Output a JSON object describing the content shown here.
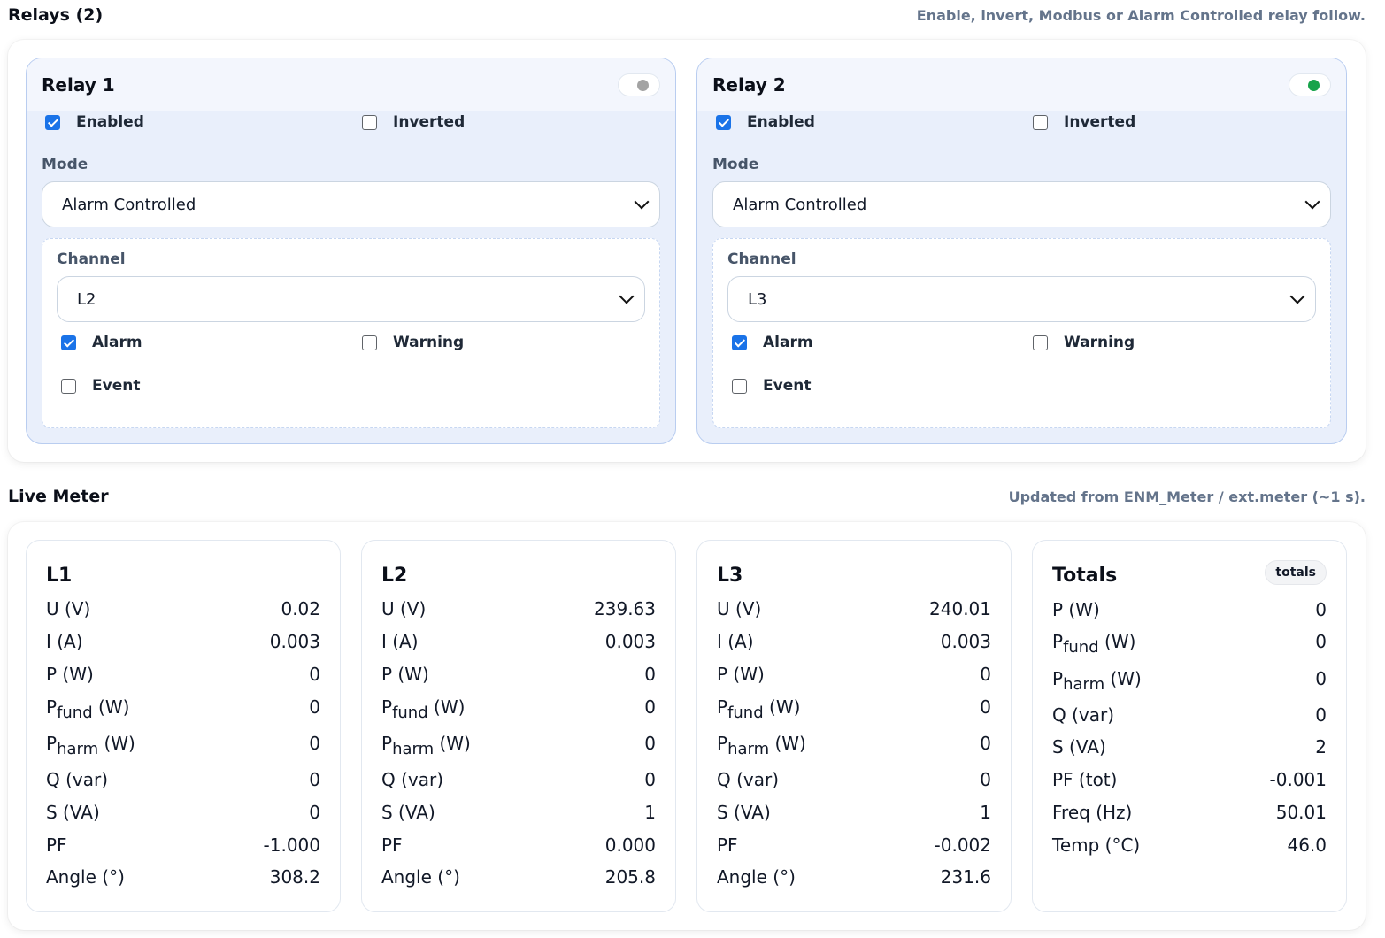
{
  "relays_section": {
    "title": "Relays (2)",
    "hint": "Enable, invert, Modbus or Alarm Controlled relay follow."
  },
  "relays": [
    {
      "title": "Relay 1",
      "status_color": "#a3a3a3",
      "enabled_label": "Enabled",
      "enabled": true,
      "inverted_label": "Inverted",
      "inverted": false,
      "mode_label": "Mode",
      "mode_value": "Alarm Controlled",
      "channel_label": "Channel",
      "channel_value": "L2",
      "alarm_label": "Alarm",
      "alarm": true,
      "warning_label": "Warning",
      "warning": false,
      "event_label": "Event",
      "event": false
    },
    {
      "title": "Relay 2",
      "status_color": "#16a34a",
      "enabled_label": "Enabled",
      "enabled": true,
      "inverted_label": "Inverted",
      "inverted": false,
      "mode_label": "Mode",
      "mode_value": "Alarm Controlled",
      "channel_label": "Channel",
      "channel_value": "L3",
      "alarm_label": "Alarm",
      "alarm": true,
      "warning_label": "Warning",
      "warning": false,
      "event_label": "Event",
      "event": false
    }
  ],
  "meter_section": {
    "title": "Live Meter",
    "hint": "Updated from ENM_Meter / ext.meter (~1 s)."
  },
  "phases": [
    {
      "title": "L1",
      "rows": [
        {
          "label": "U (V)",
          "value": "0.02"
        },
        {
          "label": "I (A)",
          "value": "0.003"
        },
        {
          "label": "P (W)",
          "value": "0"
        },
        {
          "label_main": "P",
          "label_sub": "fund",
          "label_unit": " (W)",
          "value": "0"
        },
        {
          "label_main": "P",
          "label_sub": "harm",
          "label_unit": " (W)",
          "value": "0"
        },
        {
          "label": "Q (var)",
          "value": "0"
        },
        {
          "label": "S (VA)",
          "value": "0"
        },
        {
          "label": "PF",
          "value": "-1.000"
        },
        {
          "label": "Angle (°)",
          "value": "308.2"
        }
      ]
    },
    {
      "title": "L2",
      "rows": [
        {
          "label": "U (V)",
          "value": "239.63"
        },
        {
          "label": "I (A)",
          "value": "0.003"
        },
        {
          "label": "P (W)",
          "value": "0"
        },
        {
          "label_main": "P",
          "label_sub": "fund",
          "label_unit": " (W)",
          "value": "0"
        },
        {
          "label_main": "P",
          "label_sub": "harm",
          "label_unit": " (W)",
          "value": "0"
        },
        {
          "label": "Q (var)",
          "value": "0"
        },
        {
          "label": "S (VA)",
          "value": "1"
        },
        {
          "label": "PF",
          "value": "0.000"
        },
        {
          "label": "Angle (°)",
          "value": "205.8"
        }
      ]
    },
    {
      "title": "L3",
      "rows": [
        {
          "label": "U (V)",
          "value": "240.01"
        },
        {
          "label": "I (A)",
          "value": "0.003"
        },
        {
          "label": "P (W)",
          "value": "0"
        },
        {
          "label_main": "P",
          "label_sub": "fund",
          "label_unit": " (W)",
          "value": "0"
        },
        {
          "label_main": "P",
          "label_sub": "harm",
          "label_unit": " (W)",
          "value": "0"
        },
        {
          "label": "Q (var)",
          "value": "0"
        },
        {
          "label": "S (VA)",
          "value": "1"
        },
        {
          "label": "PF",
          "value": "-0.002"
        },
        {
          "label": "Angle (°)",
          "value": "231.6"
        }
      ]
    }
  ],
  "totals": {
    "title": "Totals",
    "badge": "totals",
    "rows": [
      {
        "label": "P (W)",
        "value": "0"
      },
      {
        "label_main": "P",
        "label_sub": "fund",
        "label_unit": " (W)",
        "value": "0"
      },
      {
        "label_main": "P",
        "label_sub": "harm",
        "label_unit": " (W)",
        "value": "0"
      },
      {
        "label": "Q (var)",
        "value": "0"
      },
      {
        "label": "S (VA)",
        "value": "2"
      },
      {
        "label": "PF (tot)",
        "value": "-0.001"
      },
      {
        "label": "Freq (Hz)",
        "value": "50.01"
      },
      {
        "label": "Temp (°C)",
        "value": "46.0"
      }
    ]
  }
}
